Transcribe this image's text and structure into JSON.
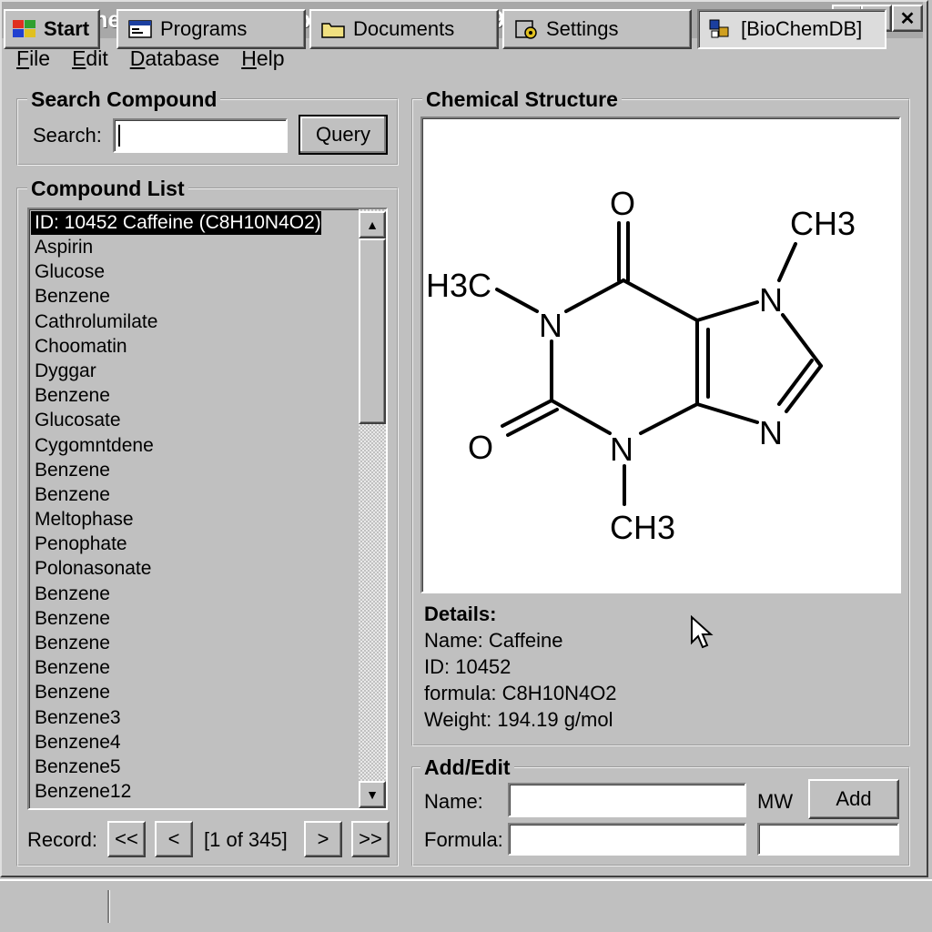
{
  "window": {
    "title": "BioChemDB v3.1 - Database:Compounds99",
    "minimize_glyph": "_",
    "maximize_glyph": "□",
    "close_glyph": "✕"
  },
  "menu": [
    "File",
    "Edit",
    "Database",
    "Help"
  ],
  "search": {
    "group_title": "Search Compound",
    "label": "Search:",
    "value": "",
    "query_label": "Query"
  },
  "compound_list": {
    "group_title": "Compound List",
    "selected": "ID: 10452 Caffeine (C8H10N4O2)",
    "items": [
      "Aspirin",
      "Glucose",
      "Benzene",
      "Cathrolumilate",
      "Choomatin",
      "Dyggar",
      "Benzene",
      "Glucosate",
      "Cygomntdene",
      "Benzene",
      "Benzene",
      "Meltophase",
      "Penophate",
      "Polonasonate",
      "Benzene",
      "Benzene",
      "Benzene",
      "Benzene",
      "Benzene",
      "Benzene3",
      "Benzene4",
      "Benzene5",
      "Benzene12"
    ],
    "scroll_up_glyph": "▲",
    "scroll_down_glyph": "▼"
  },
  "record_nav": {
    "label": "Record:",
    "first": "<<",
    "prev": "<",
    "position": "[1 of 345]",
    "next": ">",
    "last": ">>"
  },
  "structure": {
    "group_title": "Chemical Structure",
    "atoms": {
      "o_top": "O",
      "ch3_top_right": "CH3",
      "h3c_left": "H3C",
      "n1": "N",
      "n7": "N",
      "n9": "N",
      "o_left": "O",
      "n3": "N",
      "ch3_bottom": "CH3"
    }
  },
  "details": {
    "heading": "Details:",
    "name": "Name: Caffeine",
    "id": "ID: 10452",
    "formula": "formula: C8H10N4O2",
    "weight": "Weight: 194.19 g/mol"
  },
  "add_edit": {
    "group_title": "Add/Edit",
    "name_label": "Name:",
    "name_value": "",
    "mw_label": "MW",
    "add_label": "Add",
    "formula_label": "Formula:",
    "formula_value": "",
    "mw_value": ""
  },
  "taskbar": {
    "start": "Start",
    "programs": "Programs",
    "documents": "Documents",
    "settings": "Settings",
    "active_app": "[BioChemDB]"
  }
}
